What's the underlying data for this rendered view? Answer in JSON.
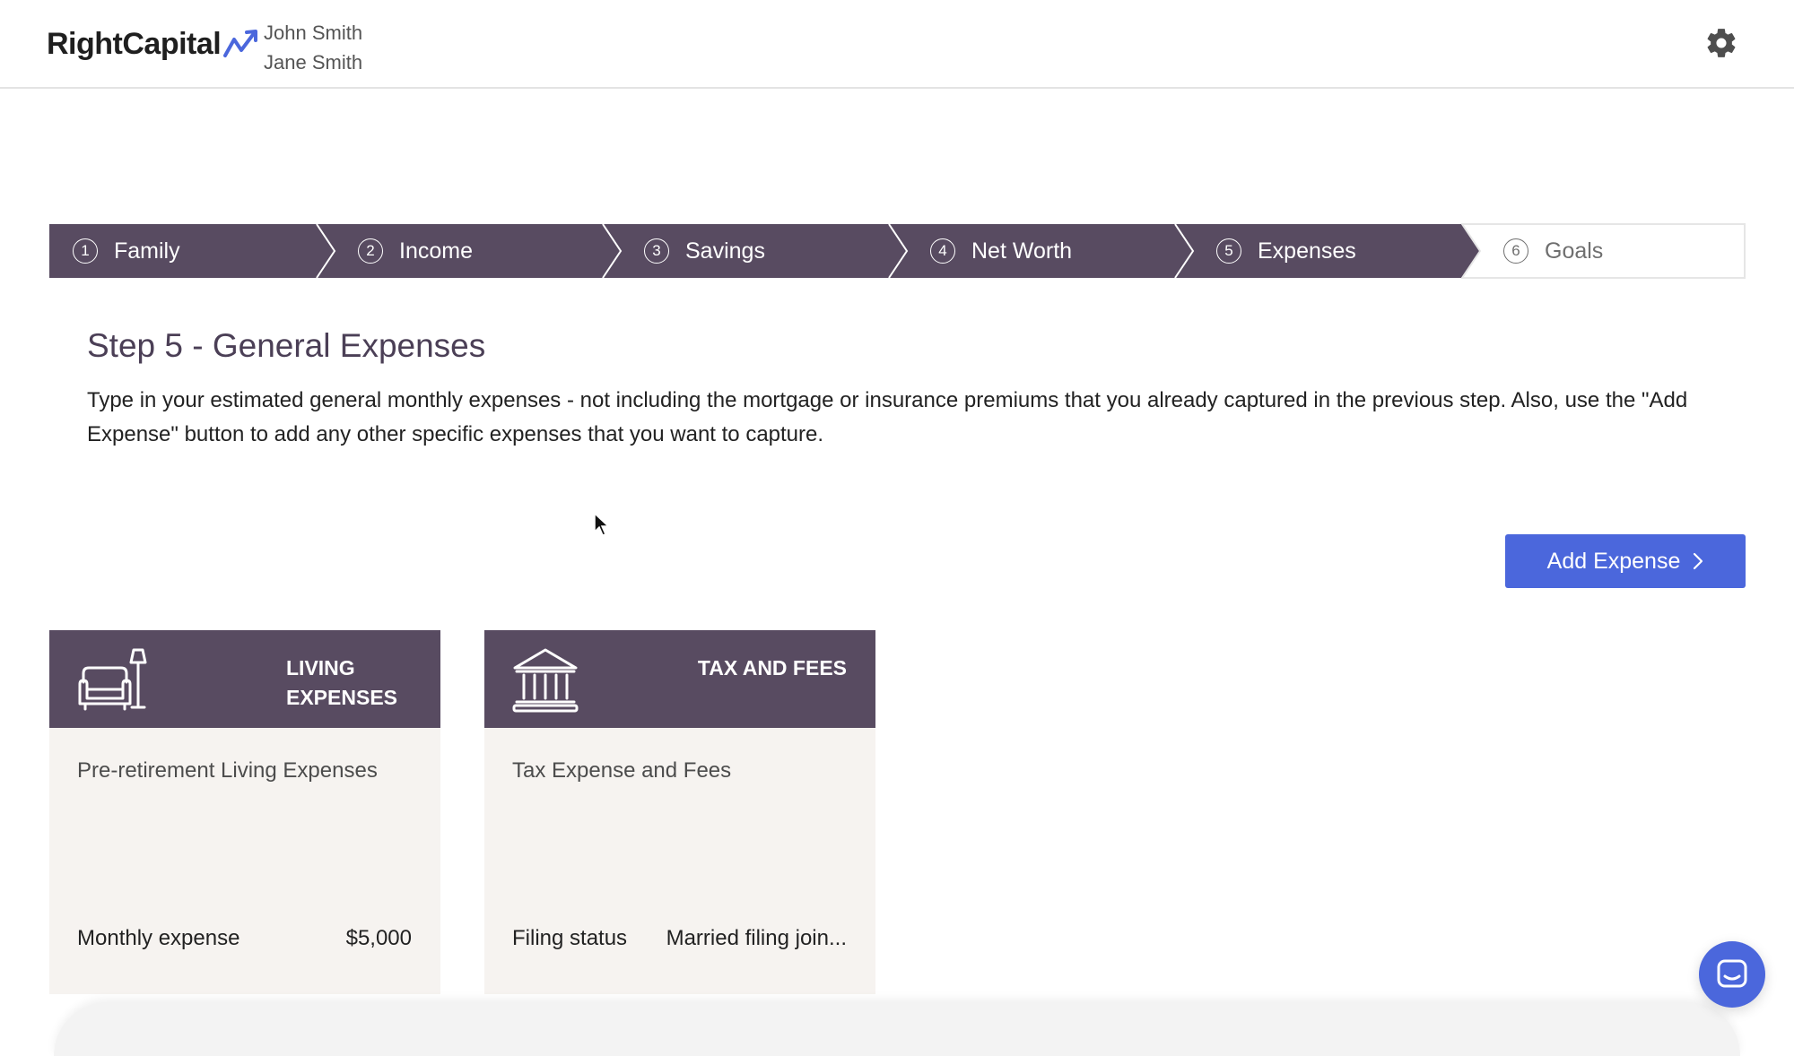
{
  "header": {
    "logo_text": "RightCapital",
    "clients": [
      "John Smith",
      "Jane Smith"
    ],
    "settings_icon": "gear-icon"
  },
  "stepper": {
    "steps": [
      {
        "num": "1",
        "label": "Family",
        "state": "complete"
      },
      {
        "num": "2",
        "label": "Income",
        "state": "complete"
      },
      {
        "num": "3",
        "label": "Savings",
        "state": "complete"
      },
      {
        "num": "4",
        "label": "Net Worth",
        "state": "complete"
      },
      {
        "num": "5",
        "label": "Expenses",
        "state": "current"
      },
      {
        "num": "6",
        "label": "Goals",
        "state": "upcoming"
      }
    ],
    "active_color": "#584b61"
  },
  "main": {
    "title": "Step 5 - General Expenses",
    "description": "Type in your estimated general monthly expenses - not including the mortgage or insurance premiums that you already captured in the previous step. Also, use the \"Add Expense\" button to add any other specific expenses that you want to capture.",
    "add_button_label": "Add Expense"
  },
  "cards": [
    {
      "category": "LIVING EXPENSES",
      "icon": "furniture-icon",
      "title": "Pre-retirement Living Expenses",
      "field_label": "Monthly expense",
      "field_value": "$5,000"
    },
    {
      "category": "TAX AND FEES",
      "icon": "bank-icon",
      "title": "Tax Expense and Fees",
      "field_label": "Filing status",
      "field_value": "Married filing join..."
    }
  ],
  "colors": {
    "brand_accent": "#4b67dc",
    "card_header": "#584b61",
    "card_body": "#f6f3f0"
  }
}
